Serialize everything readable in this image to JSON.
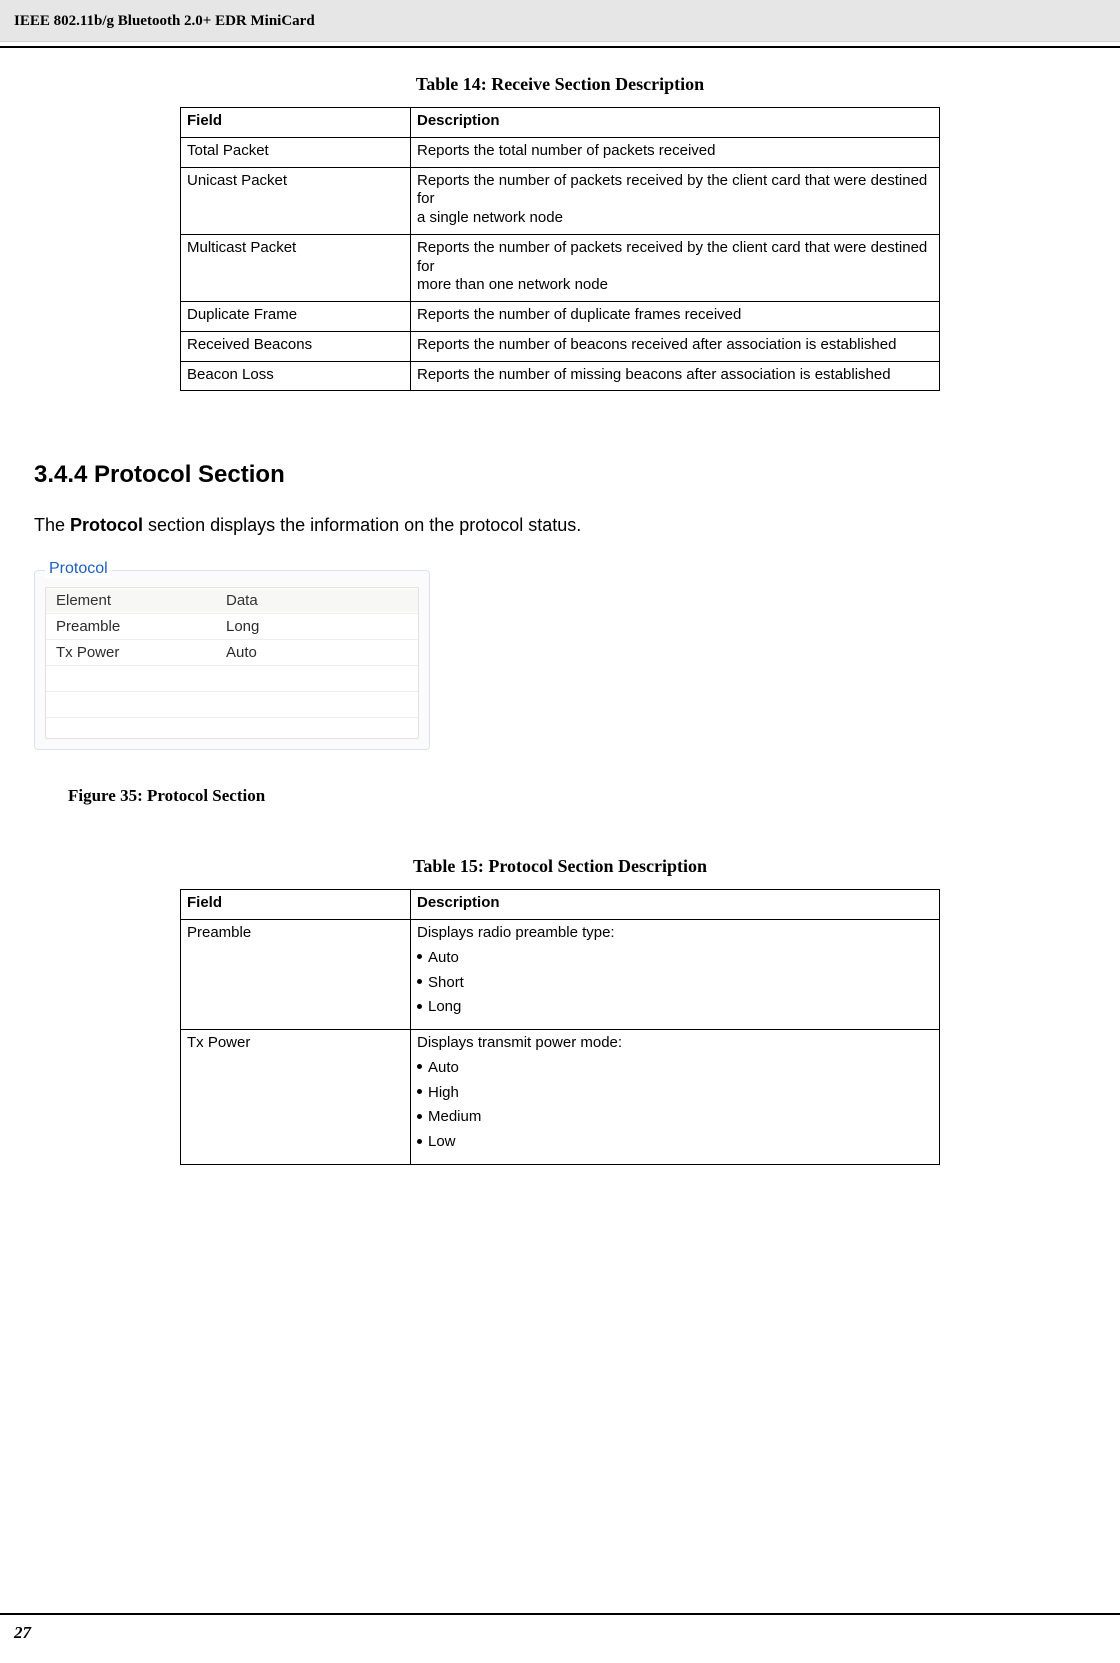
{
  "header": {
    "title_small": "IEEE 802.11b/g Bluetooth 2.0+ EDR MiniCard"
  },
  "table14": {
    "caption": "Table 14: Receive Section Description",
    "headers": {
      "field": "Field",
      "description": "Description"
    },
    "rows": [
      {
        "field": "Total Packet",
        "description": "Reports the total number of packets received"
      },
      {
        "field": "Unicast Packet",
        "description": "Reports the number of packets received by the client card that were destined for\na single network node"
      },
      {
        "field": "Multicast Packet",
        "description": "Reports the number of packets received by the client card that were destined for\nmore than one network node"
      },
      {
        "field": "Duplicate Frame",
        "description": "Reports the number of duplicate frames received"
      },
      {
        "field": "Received Beacons",
        "description": "Reports the number of beacons received after association is established"
      },
      {
        "field": "Beacon Loss",
        "description": "Reports the number of missing beacons after association is established"
      }
    ]
  },
  "section": {
    "heading": "3.4.4 Protocol Section",
    "body_prefix": "The ",
    "body_strong": "Protocol",
    "body_suffix": " section displays the information on the protocol status."
  },
  "protocol_box": {
    "legend": "Protocol",
    "headers": {
      "element": "Element",
      "data": "Data"
    },
    "rows": [
      {
        "element": "Preamble",
        "data": "Long"
      },
      {
        "element": "Tx Power",
        "data": "Auto"
      }
    ]
  },
  "figure35_caption": "Figure 35: Protocol Section",
  "table15": {
    "caption": "Table 15: Protocol Section Description",
    "headers": {
      "field": "Field",
      "description": "Description"
    },
    "rows": [
      {
        "field": "Preamble",
        "lead": "Displays radio preamble type:",
        "bullets": [
          "Auto",
          "Short",
          "Long"
        ]
      },
      {
        "field": "Tx Power",
        "lead": "Displays transmit power mode:",
        "bullets": [
          "Auto",
          "High",
          "Medium",
          "Low"
        ]
      }
    ]
  },
  "footer": {
    "page_no": "27"
  }
}
